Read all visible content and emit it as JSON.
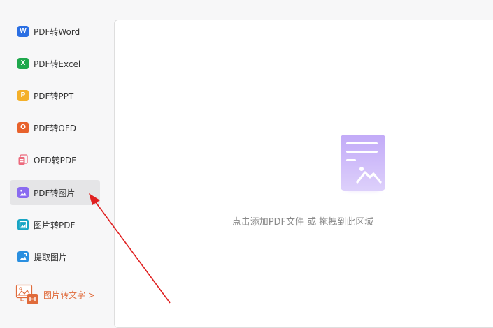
{
  "sidebar": {
    "items": [
      {
        "label": "PDF转Word",
        "icon": "word-icon",
        "glyph": "W",
        "color": "#2b6fe3"
      },
      {
        "label": "PDF转Excel",
        "icon": "excel-icon",
        "glyph": "X",
        "color": "#1fa84d"
      },
      {
        "label": "PDF转PPT",
        "icon": "ppt-icon",
        "glyph": "P",
        "color": "#f4b02a"
      },
      {
        "label": "PDF转OFD",
        "icon": "ofd-icon",
        "glyph": "O",
        "color": "#e8622c"
      },
      {
        "label": "OFD转PDF",
        "icon": "pdf-icon",
        "glyph": "",
        "color": "#ec6a7d"
      },
      {
        "label": "PDF转图片",
        "icon": "pdf-to-image-icon",
        "glyph": "",
        "color": "#8a6bf0",
        "active": true
      },
      {
        "label": "图片转PDF",
        "icon": "image-to-pdf-icon",
        "glyph": "",
        "color": "#18a5c4"
      },
      {
        "label": "提取图片",
        "icon": "extract-image-icon",
        "glyph": "",
        "color": "#2a8fe0"
      }
    ],
    "ocr_link": {
      "label": "图片转文字 >",
      "icon": "ocr-icon",
      "color": "#e06b3b"
    }
  },
  "main": {
    "drop_hint": "点击添加PDF文件 或 拖拽到此区域",
    "drop_icon": "document-image-icon",
    "accent": "#b69cf7"
  },
  "annotation": {
    "arrow_color": "#e02020"
  }
}
